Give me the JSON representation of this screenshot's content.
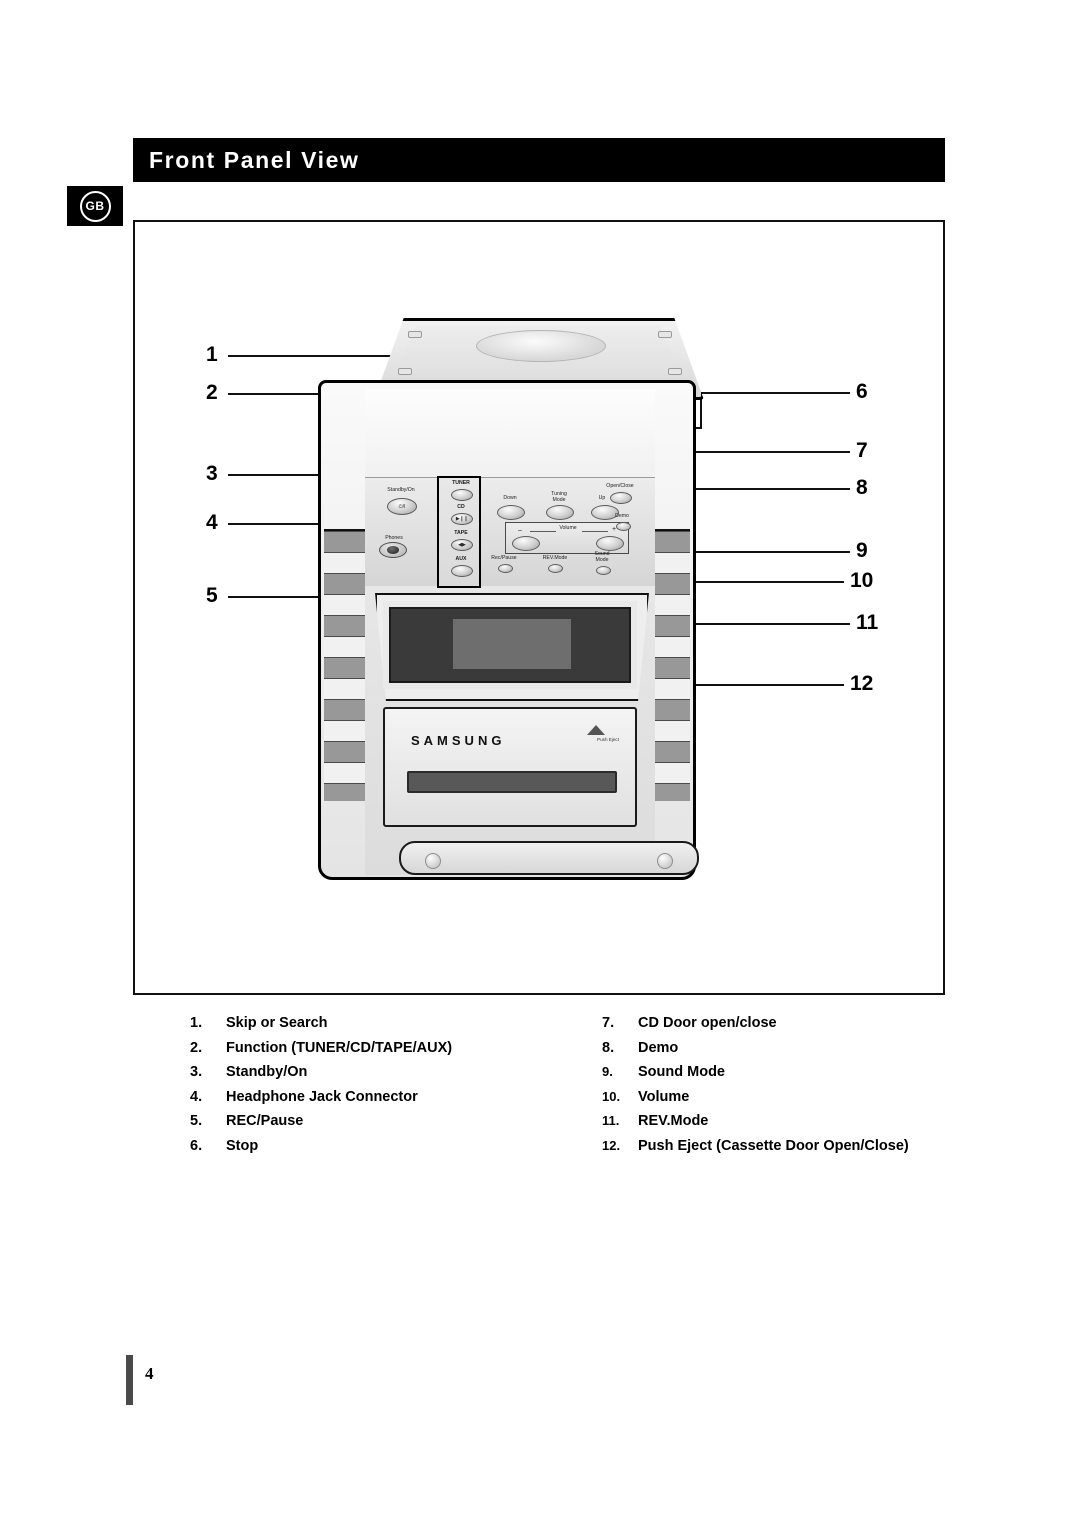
{
  "header": {
    "title": "Front Panel View",
    "language_badge": "GB"
  },
  "diagram": {
    "brand_logo": "SAMSUNG",
    "eject_marker_label": "Push Eject",
    "callout_numbers_left": [
      "1",
      "2",
      "3",
      "4",
      "5"
    ],
    "callout_numbers_right": [
      "6",
      "7",
      "8",
      "9",
      "10",
      "11",
      "12"
    ],
    "control_labels": {
      "standby": "Standby/On",
      "phones": "Phones",
      "tuner": "TUNER",
      "cd": "CD",
      "tape": "TAPE",
      "aux": "AUX",
      "down": "Down",
      "tuning_mode_line1": "Tuning",
      "tuning_mode_line2": "Mode",
      "up": "Up",
      "volume": "Volume",
      "volume_minus": "–",
      "volume_plus": "+",
      "rec_pause": "Rec/Pause",
      "rev_mode": "REV.Mode",
      "sound_mode_line1": "Sound",
      "sound_mode_line2": "Mode",
      "open_close": "Open/Close",
      "demo": "Demo"
    },
    "button_glyphs": {
      "standby_power": "⏻/I",
      "cd_play_pause": "▶❙❙",
      "tape_play": "◀▶",
      "tuner": "▬"
    }
  },
  "legend": {
    "left": [
      {
        "num": "1.",
        "label": "Skip or Search"
      },
      {
        "num": "2.",
        "label": "Function (TUNER/CD/TAPE/AUX)"
      },
      {
        "num": "3.",
        "label": "Standby/On"
      },
      {
        "num": "4.",
        "label": "Headphone Jack Connector"
      },
      {
        "num": "5.",
        "label": "REC/Pause"
      },
      {
        "num": "6.",
        "label": "Stop"
      }
    ],
    "right": [
      {
        "num": "7.",
        "label": "CD Door open/close"
      },
      {
        "num": "8.",
        "label": "Demo"
      },
      {
        "num": "9.",
        "label": "Sound Mode"
      },
      {
        "num": "10.",
        "label": "Volume"
      },
      {
        "num": "11.",
        "label": "REV.Mode"
      },
      {
        "num": "12.",
        "label": "Push Eject (Cassette Door Open/Close)"
      }
    ]
  },
  "footer": {
    "page_number": "4"
  },
  "colors": {
    "title_bar_bg": "#000000",
    "title_text": "#ffffff",
    "page_bg": "#ffffff",
    "line": "#111111",
    "grille_dark": "#989898",
    "grille_light": "#f1f1f1",
    "display_bg": "#3a3a3a"
  }
}
